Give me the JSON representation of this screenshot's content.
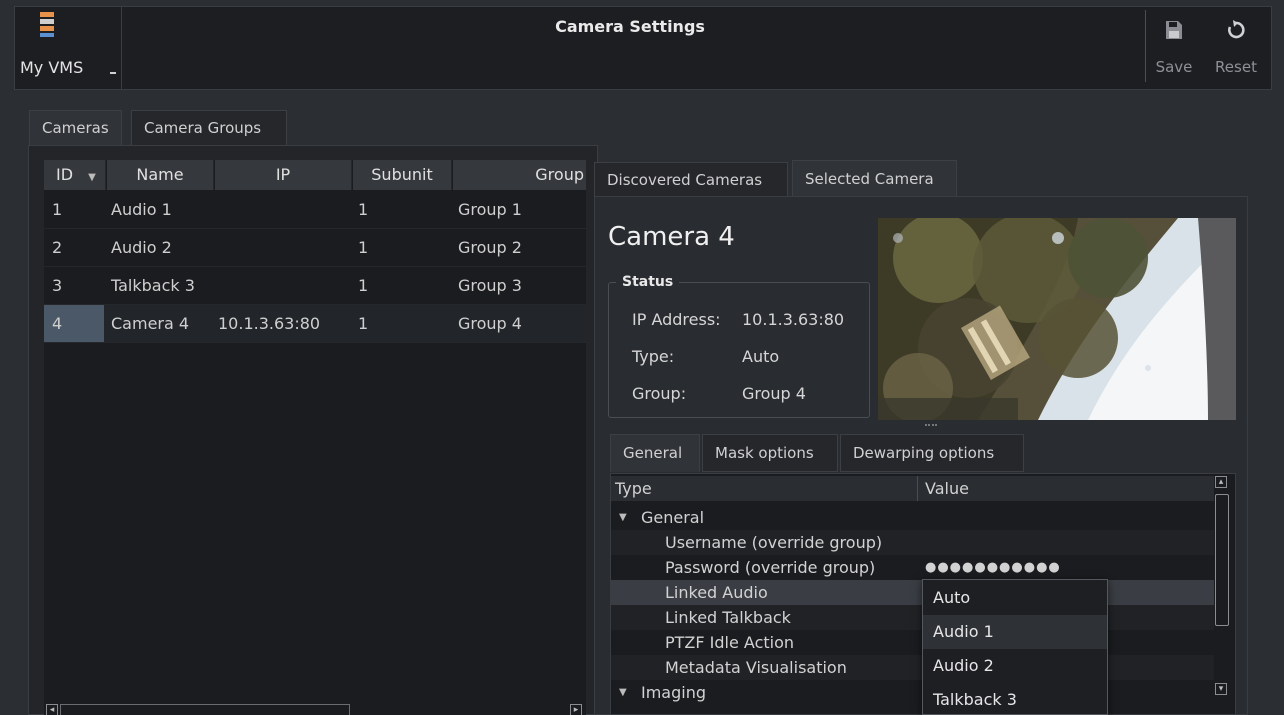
{
  "app": {
    "title": "Camera Settings",
    "brand_label": "My VMS",
    "save_label": "Save",
    "reset_label": "Reset"
  },
  "left_tabs": [
    "Cameras",
    "Camera Groups"
  ],
  "camera_table": {
    "columns": [
      "ID",
      "Name",
      "IP",
      "Subunit",
      "Group"
    ],
    "rows": [
      {
        "id": "1",
        "name": "Audio 1",
        "ip": "",
        "subunit": "1",
        "group": "Group 1"
      },
      {
        "id": "2",
        "name": "Audio 2",
        "ip": "",
        "subunit": "1",
        "group": "Group 2"
      },
      {
        "id": "3",
        "name": "Talkback 3",
        "ip": "",
        "subunit": "1",
        "group": "Group 3"
      },
      {
        "id": "4",
        "name": "Camera 4",
        "ip": "10.1.3.63:80",
        "subunit": "1",
        "group": "Group 4"
      }
    ],
    "selected_row": "4"
  },
  "right_tabs": [
    "Discovered Cameras",
    "Selected Camera"
  ],
  "selected_camera": {
    "name": "Camera 4",
    "status_title": "Status",
    "status": [
      {
        "key": "IP Address:",
        "value": "10.1.3.63:80"
      },
      {
        "key": "Type:",
        "value": "Auto"
      },
      {
        "key": "Group:",
        "value": "Group 4"
      }
    ]
  },
  "settings_tabs": [
    "General",
    "Mask options",
    "Dewarping options"
  ],
  "property_tree": {
    "headers": {
      "type": "Type",
      "value": "Value"
    },
    "rows": [
      {
        "label": "General",
        "value": "",
        "group": true
      },
      {
        "label": "Username (override group)",
        "value": ""
      },
      {
        "label": "Password (override group)",
        "value": "●●●●●●●●●●●"
      },
      {
        "label": "Linked Audio",
        "value": ""
      },
      {
        "label": "Linked Talkback",
        "value": ""
      },
      {
        "label": "PTZF Idle Action",
        "value": ""
      },
      {
        "label": "Metadata Visualisation",
        "value": ""
      },
      {
        "label": "Imaging",
        "value": "",
        "group": true
      }
    ]
  },
  "dropdown": {
    "options": [
      "Auto",
      "Audio 1",
      "Audio 2",
      "Talkback 3"
    ],
    "hovered": "Audio 1"
  },
  "icons": {
    "brand": "server-stack-icon",
    "save": "floppy-disk-icon",
    "reset": "reset-arrow-icon",
    "sort": "sort-descending-icon",
    "expand": "triangle-down-icon"
  }
}
